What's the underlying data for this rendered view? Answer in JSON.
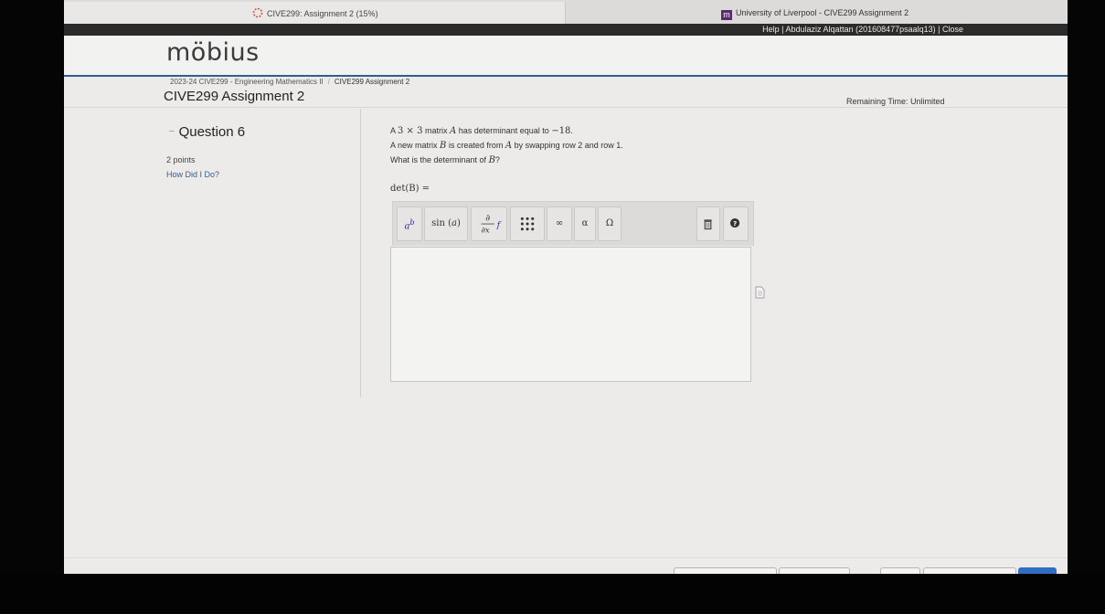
{
  "browser": {
    "tab_active": "CIVE299: Assignment 2 (15%)",
    "tab_other": "University of Liverpool - CIVE299 Assignment 2"
  },
  "helpbar": {
    "text": "Help | Abdulaziz Alqattan (201608477psaalq13) | Close"
  },
  "brand": {
    "logo": "möbius",
    "accent": "#2f5f8f"
  },
  "breadcrumb": {
    "course": "2023-24 CIVE299 - Engineering Mathematics II",
    "separator": "/",
    "current": "CIVE299 Assignment 2"
  },
  "page": {
    "title": "CIVE299 Assignment 2",
    "remaining_time": "Remaining Time: Unlimited"
  },
  "question": {
    "title": "Question 6",
    "points": "2 points",
    "how_did_i_do": "How Did I Do?",
    "line1": {
      "p1": "A ",
      "m1": "3 × 3",
      "p2": " matrix ",
      "m2": "A",
      "p3": " has determinant equal to ",
      "m3": "−18",
      "p4": "."
    },
    "line2": {
      "p1": "A new matrix ",
      "m1": "B",
      "p2": " is created from ",
      "m2": "A",
      "p3": " by swapping row 2 and row 1."
    },
    "line3": {
      "p1": "What is the determinant of ",
      "m1": "B",
      "p2": "?"
    },
    "answer_label": "det(B) ="
  },
  "editor": {
    "buttons": {
      "power": "ab",
      "sin": "sin (a)",
      "deriv": "∂/∂x f",
      "matrix": "matrix",
      "infinity": "∞",
      "alpha": "α",
      "omega": "Ω",
      "delete": "trash",
      "help": "?"
    },
    "value": ""
  }
}
